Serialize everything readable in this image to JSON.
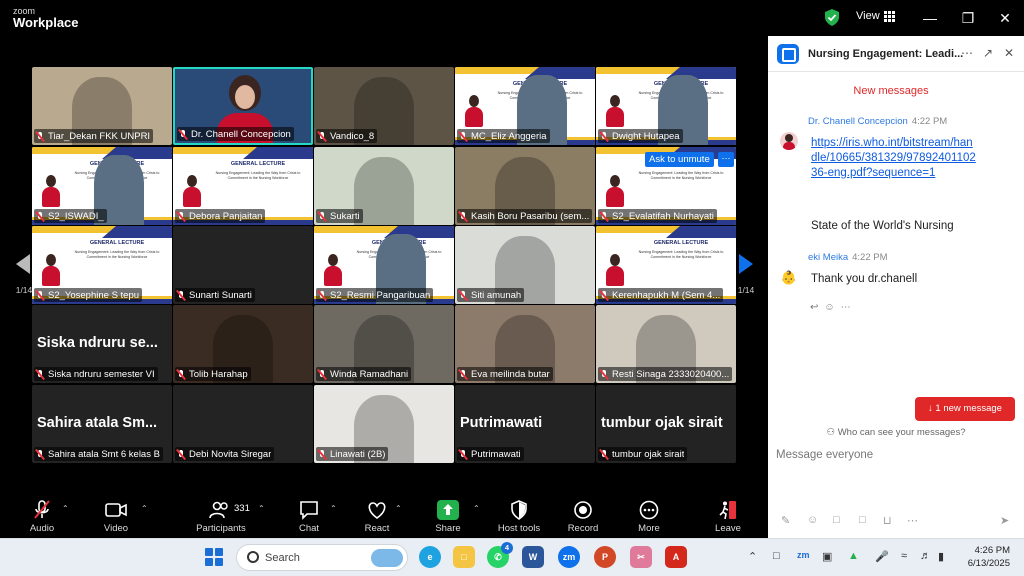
{
  "app": {
    "logo_top": "zoom",
    "logo_bottom": "Workplace",
    "view_label": "View"
  },
  "tiles": [
    {
      "name": "Tiar_Dekan FKK UNPRI",
      "kind": "cam",
      "bg": "#b9a98e"
    },
    {
      "name": "Dr. Chanell Concepcion",
      "kind": "speaker",
      "bg": "#2a4a78"
    },
    {
      "name": "Vandico_8",
      "kind": "cam",
      "bg": "#5e5446"
    },
    {
      "name": "MC_Eliz Anggeria",
      "kind": "slidecam",
      "bg": "#ffffff"
    },
    {
      "name": "Dwight Hutapea",
      "kind": "slidecam",
      "bg": "#ffffff"
    },
    {
      "name": "S2_ISWADI_",
      "kind": "slidecam",
      "bg": "#ffffff"
    },
    {
      "name": "Debora Panjaitan",
      "kind": "slide",
      "bg": "#ffffff"
    },
    {
      "name": "Sukarti",
      "kind": "cam",
      "bg": "#cfd8c9"
    },
    {
      "name": "Kasih Boru Pasaribu (sem...",
      "kind": "cam",
      "bg": "#8a7d63"
    },
    {
      "name": "S2_Evalatifah Nurhayati",
      "kind": "slide",
      "bg": "#ffffff"
    },
    {
      "name": "S2_Yosephine S tepu",
      "kind": "slide",
      "bg": "#ffffff"
    },
    {
      "name": "Sunarti Sunarti",
      "kind": "blank",
      "bg": "#232323"
    },
    {
      "name": "S2_Resmi Pangaribuan",
      "kind": "slidecam",
      "bg": "#ffffff"
    },
    {
      "name": "Siti amunah",
      "kind": "cam",
      "bg": "#d9dcd7"
    },
    {
      "name": "Kerenhapukh M (Sem 4...",
      "kind": "slide",
      "bg": "#ffffff"
    },
    {
      "name": "Siska ndruru semester VI",
      "kind": "text",
      "big": "Siska ndruru se...",
      "bg": "#232323"
    },
    {
      "name": "Tolib Harahap",
      "kind": "cam",
      "bg": "#3a2c22"
    },
    {
      "name": "Winda Ramadhani",
      "kind": "cam",
      "bg": "#6e6961"
    },
    {
      "name": "Eva meilinda butar",
      "kind": "cam",
      "bg": "#8c7a6a"
    },
    {
      "name": "Resti Sinaga 2333020400...",
      "kind": "cam",
      "bg": "#cfc9be"
    },
    {
      "name": "Sahira atala Smt 6 kelas B",
      "kind": "text",
      "big": "Sahira atala Sm...",
      "bg": "#232323"
    },
    {
      "name": "Debi Novita Siregar",
      "kind": "blank",
      "bg": "#232323"
    },
    {
      "name": "Linawati (2B)",
      "kind": "cam",
      "bg": "#e8e6e2"
    },
    {
      "name": "Putrimawati",
      "kind": "text",
      "big": "Putrimawati",
      "bg": "#232323"
    },
    {
      "name": "tumbur ojak sirait",
      "kind": "text",
      "big": "tumbur ojak sirait",
      "bg": "#232323"
    }
  ],
  "slide": {
    "title": "GENERAL LECTURE",
    "subtitle": "Nursing Engagement: Leading the Way from Crisis to Commitment in the Nursing Workforce",
    "date": "Thrusday, 13 June 2025",
    "speaker": "Guest Lecture: Chanell Jan Concepcion, PhD, RN"
  },
  "ask_unmute": "Ask to unmute",
  "pager": {
    "left": "1/14",
    "right": "1/14"
  },
  "toolbar": {
    "audio": "Audio",
    "video": "Video",
    "participants": "Participants",
    "participants_count": "331",
    "chat": "Chat",
    "react": "React",
    "share": "Share",
    "host_tools": "Host tools",
    "record": "Record",
    "more": "More",
    "leave": "Leave"
  },
  "chat": {
    "title": "Nursing Engagement: Leadi...",
    "new_messages": "New messages",
    "messages": [
      {
        "sender": "Dr. Chanell Concepcion",
        "time": "4:22 PM",
        "link": "https://iris.who.int/bitstream/handle/10665/381329/9789240110236-eng.pdf?sequence=1",
        "text": "State of the World's Nursing"
      },
      {
        "sender": "eki Meika",
        "time": "4:22 PM",
        "text": "Thank you dr.chanell"
      }
    ],
    "new_button": "1 new message",
    "who_can_see": "Who can see your messages?",
    "placeholder": "Message everyone"
  },
  "taskbar": {
    "search": "Search",
    "whatsapp_badge": "4",
    "time": "4:26 PM",
    "date": "6/13/2025"
  }
}
